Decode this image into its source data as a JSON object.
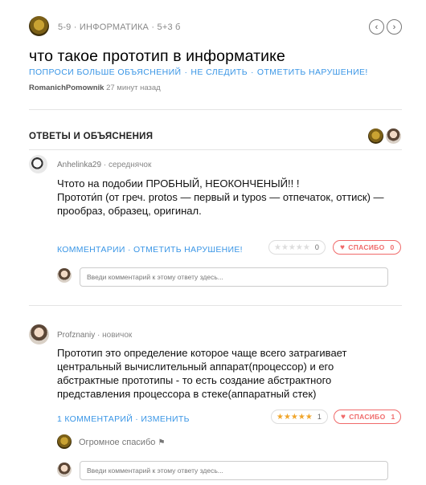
{
  "header": {
    "meta_grade": "5-9",
    "meta_subject": "ИНФОРМАТИКА",
    "meta_points": "5+3 б",
    "nav_prev": "‹",
    "nav_next": "›"
  },
  "question": {
    "title": "что такое прототип в информатике",
    "link_ask_more": "ПОПРОСИ БОЛЬШЕ ОБЪЯСНЕНИЙ",
    "link_unfollow": "НЕ СЛЕДИТЬ",
    "link_report": "ОТМЕТИТЬ НАРУШЕНИЕ!",
    "author": "RomanichPomownik",
    "time": "27 минут назад",
    "separator": "·"
  },
  "answers_section": {
    "title": "ОТВЕТЫ И ОБЪЯСНЕНИЯ"
  },
  "answers": [
    {
      "username": "Anhelinka29",
      "rank": "середнячок",
      "text_lines": [
        "Чтото на подобии ПРОБНЫЙ, НЕОКОНЧЕНЫЙ!! !",
        "Прототи́п (от греч. protos — первый и typos — отпечаток, оттиск) —",
        "прообраз, образец, оригинал."
      ],
      "link_comments": "КОММЕНТАРИИ",
      "link_second": "ОТМЕТИТЬ НАРУШЕНИЕ!",
      "stars": "★★★★★",
      "rating_count": "0",
      "thanks_label": "СПАСИБО",
      "thanks_count": "0",
      "comment_placeholder": "Введи комментарий к этому ответу здесь..."
    },
    {
      "username": "Profznaniy",
      "rank": "новичок",
      "text_lines": [
        "Прототип это определение которое чаще всего затрагивает",
        "центральный вычислительный аппарат(процессор) и его",
        "абстрактные прототипы - то есть создание абстрактного",
        "представления процессора в стеке(аппаратный стек)"
      ],
      "link_comments": "1 КОММЕНТАРИЙ",
      "link_second": "ИЗМЕНИТЬ",
      "stars": "★★★★★",
      "rating_count": "1",
      "thanks_label": "СПАСИБО",
      "thanks_count": "1",
      "existing_comment": "Огромное спасибо",
      "comment_placeholder": "Введи комментарий к этому ответу здесь..."
    }
  ],
  "colors": {
    "link_blue": "#3a96e6",
    "thanks_red": "#f06a6a",
    "star_gold": "#f0a52b"
  }
}
